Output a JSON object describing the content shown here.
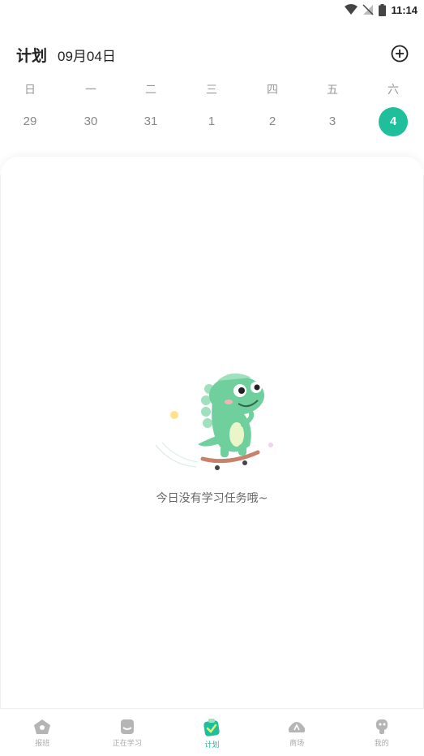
{
  "status_bar": {
    "time": "11:14"
  },
  "header": {
    "title": "计划",
    "date": "09月04日"
  },
  "week": {
    "weekdays": [
      "日",
      "一",
      "二",
      "三",
      "四",
      "五",
      "六"
    ],
    "days": [
      "29",
      "30",
      "31",
      "1",
      "2",
      "3",
      "4"
    ],
    "selected_index": 6
  },
  "empty_state": {
    "message": "今日没有学习任务哦~"
  },
  "bottom_nav": {
    "items": [
      {
        "label": "报班",
        "icon": "home-icon"
      },
      {
        "label": "正在学习",
        "icon": "book-icon"
      },
      {
        "label": "计划",
        "icon": "plan-icon"
      },
      {
        "label": "商场",
        "icon": "store-icon"
      },
      {
        "label": "我的",
        "icon": "profile-icon"
      }
    ],
    "active_index": 2
  },
  "colors": {
    "accent": "#1fbf9c",
    "background": "#f3f4f6"
  }
}
